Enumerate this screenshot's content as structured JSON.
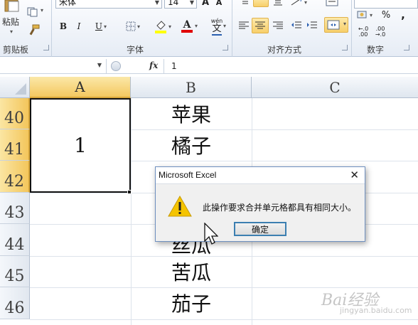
{
  "ribbon": {
    "clipboard": {
      "paste_label": "粘贴",
      "group_label": "剪贴板"
    },
    "font": {
      "font_name": "宋体",
      "font_size": "14",
      "bold": "B",
      "italic": "I",
      "underline": "U",
      "font_color_glyph": "A",
      "wen_glyph": "wén",
      "wen_char": "文",
      "grow_glyph": "A",
      "group_label": "字体"
    },
    "alignment": {
      "group_label": "对齐方式"
    },
    "number": {
      "percent": "%",
      "comma": ",",
      "inc_decimal_top": "←.0",
      "inc_decimal_bottom": ".00",
      "dec_decimal_top": ".00",
      "dec_decimal_bottom": "→.0",
      "group_label": "数字"
    }
  },
  "formula_bar": {
    "name_box_value": "",
    "fx_label": "fx",
    "formula_value": "1"
  },
  "grid": {
    "columns": [
      "A",
      "B",
      "C"
    ],
    "rows": [
      "40",
      "41",
      "42",
      "43",
      "44",
      "45",
      "46"
    ],
    "merged_value": "1",
    "column_b": [
      "苹果",
      "橘子",
      "",
      "",
      "丝瓜",
      "苦瓜",
      "茄子"
    ]
  },
  "dialog": {
    "title": "Microsoft Excel",
    "close_glyph": "✕",
    "message": "此操作要求合并单元格都具有相同大小。",
    "ok_label": "确定"
  },
  "watermark": {
    "brand": "Bai经验",
    "sub": "jingyan.baidu.com"
  },
  "colors": {
    "selection_header": "#f4c860",
    "dialog_border": "#6e8fbf",
    "ok_border": "#3c7fb1",
    "warning_yellow": "#f5c400"
  }
}
